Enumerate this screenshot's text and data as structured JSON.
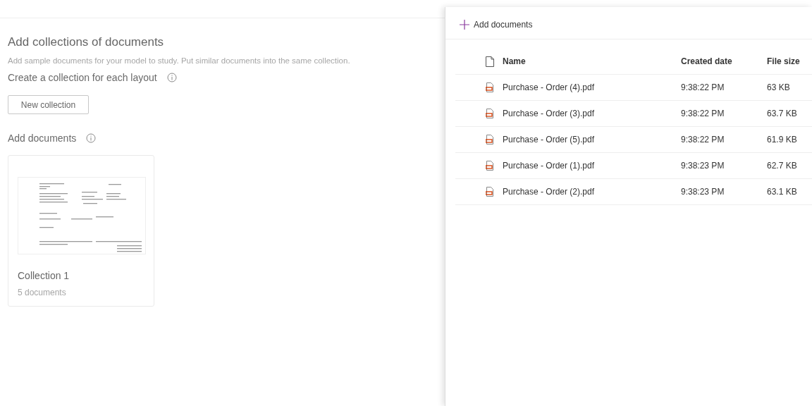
{
  "main": {
    "title": "Add collections of documents",
    "description": "Add sample documents for your model to study. Put similar documents into the same collection.",
    "collection_heading": "Create a collection for each layout",
    "new_collection_button": "New collection",
    "documents_heading": "Add documents",
    "collections": [
      {
        "name": "Collection 1",
        "count": "5 documents"
      }
    ]
  },
  "panel": {
    "add_button": "Add documents",
    "table": {
      "columns": [
        "Name",
        "Created date",
        "File size"
      ],
      "rows": [
        {
          "name": "Purchase - Order (4).pdf",
          "created": "9:38:22 PM",
          "size": "63 KB"
        },
        {
          "name": "Purchase - Order (3).pdf",
          "created": "9:38:22 PM",
          "size": "63.7 KB"
        },
        {
          "name": "Purchase - Order (5).pdf",
          "created": "9:38:22 PM",
          "size": "61.9 KB"
        },
        {
          "name": "Purchase - Order (1).pdf",
          "created": "9:38:23 PM",
          "size": "62.7 KB"
        },
        {
          "name": "Purchase - Order (2).pdf",
          "created": "9:38:23 PM",
          "size": "63.1 KB"
        }
      ]
    }
  }
}
